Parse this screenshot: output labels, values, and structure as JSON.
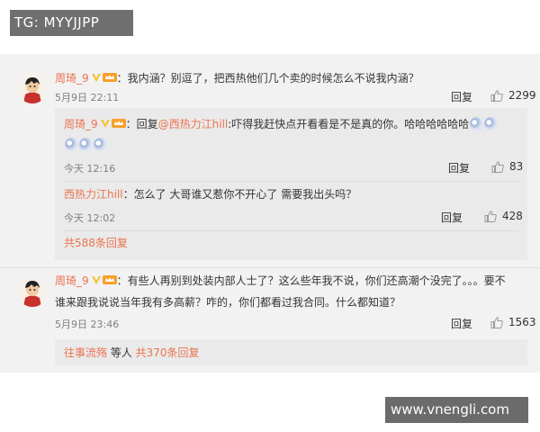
{
  "overlay": {
    "tg_label": "TG: MYYJJPP",
    "watermark": "www.vnengli.com"
  },
  "comment1": {
    "username": "周琦_9",
    "text": "：我内涵？别逗了，把西热他们几个卖的时候怎么不说我内涵？",
    "time": "5月9日 22:11",
    "reply_label": "回复",
    "likes": "2299"
  },
  "sub1": {
    "username": "周琦_9",
    "prefix": "：回复",
    "mention": "@西热力江hill",
    "text_line1": ":吓得我赶快点开看看是不是真的你。哈哈哈哈哈哈",
    "time": "今天 12:16",
    "reply_label": "回复",
    "likes": "83"
  },
  "sub2": {
    "username": "西热力江hill",
    "text": "：怎么了 大哥谁又惹你不开心了 需要我出头吗？",
    "time": "今天 12:02",
    "reply_label": "回复",
    "likes": "428"
  },
  "more1": {
    "label": "共588条回复"
  },
  "comment2": {
    "username": "周琦_9",
    "text_line1": "：有些人再别到处装内部人士了？这么些年我不说，你们还高潮个没完了。。。要不",
    "text_line2": "谁来跟我说说当年我有多高薪？咋的，你们都看过我合同。什么都知道？",
    "time": "5月9日 23:46",
    "reply_label": "回复",
    "likes": "1563"
  },
  "more2": {
    "user": "往事流殇",
    "mid": " 等人 ",
    "count": "共370条回复"
  },
  "colors": {
    "accent": "#eb7350",
    "vip": "#f7a02a",
    "badge": "#f5c22a"
  }
}
